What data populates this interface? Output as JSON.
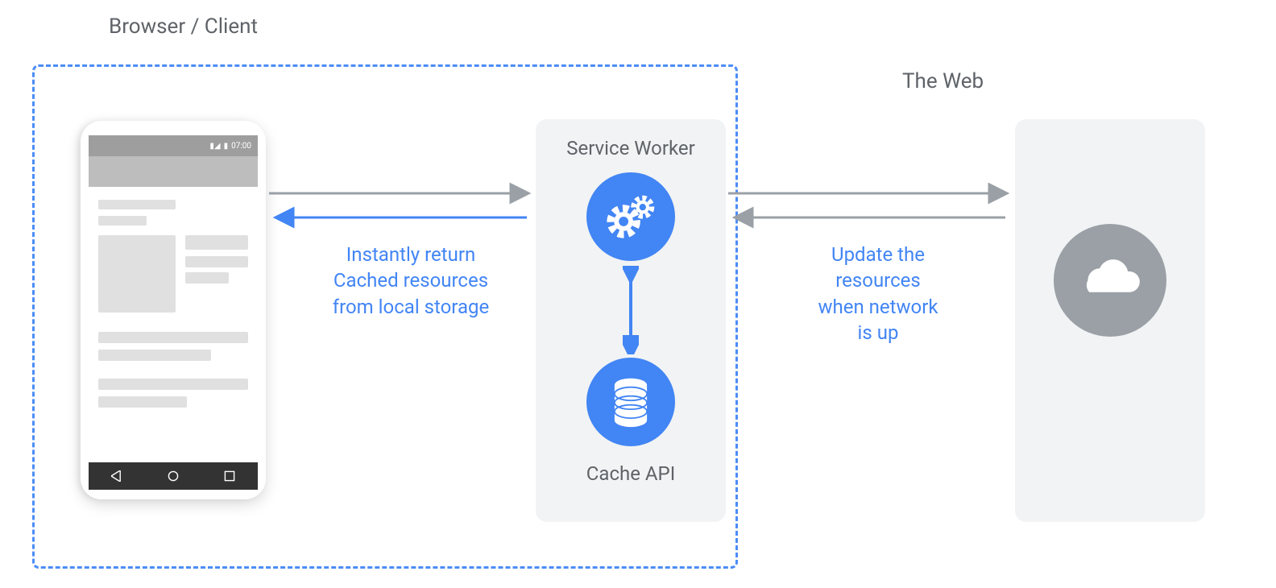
{
  "labels": {
    "browser_client": "Browser / Client",
    "the_web": "The Web",
    "service_worker": "Service Worker",
    "cache_api": "Cache API"
  },
  "captions": {
    "cache_return": "Instantly return\nCached resources\nfrom local storage",
    "network_update": "Update the\nresources\nwhen network\nis up"
  },
  "phone": {
    "clock": "07:00"
  },
  "icons": {
    "gears": "gears-icon",
    "database": "database-icon",
    "cloud": "cloud-icon"
  },
  "colors": {
    "blue": "#4285f4",
    "grey": "#9aa0a6",
    "panel": "#f1f3f4",
    "text_grey": "#5f6368"
  }
}
